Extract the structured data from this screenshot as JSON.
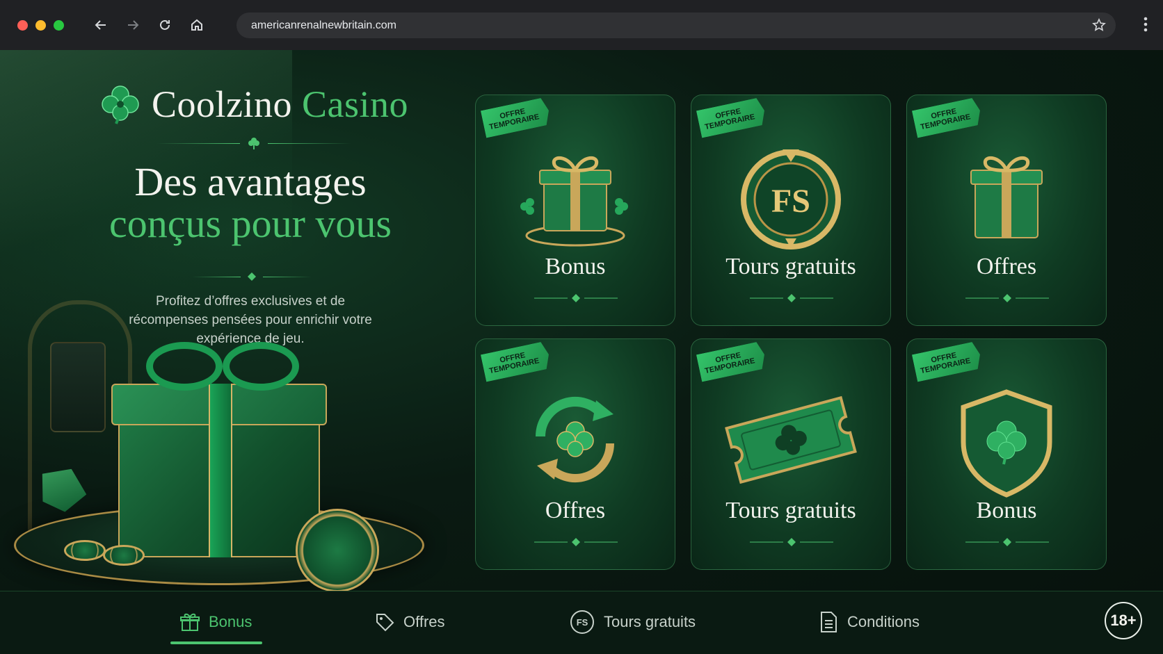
{
  "browser": {
    "url": "americanrenalnewbritain.com",
    "traffic_lights": [
      "#ff5f57",
      "#febc2e",
      "#28c840"
    ],
    "icons": [
      "back-icon",
      "forward-icon",
      "reload-icon",
      "home-icon",
      "star-icon",
      "menu-icon"
    ]
  },
  "brand": {
    "name_part1": "Coolzino",
    "name_part2": "Casino",
    "logo_icon": "clover-icon"
  },
  "hero": {
    "title_line1": "Des avantages",
    "title_line2": "conçus pour vous",
    "description": "Profitez d’offres exclusives et de récompenses pensées pour enrichir votre expérience de jeu."
  },
  "colors": {
    "accent": "#4cc46f",
    "gold": "#c9a75a",
    "background": "#07110c"
  },
  "cards": [
    {
      "ribbon_line1": "OFFRE",
      "ribbon_line2": "TEMPORAIRE",
      "title": "Bonus",
      "icon": "gift-icon"
    },
    {
      "ribbon_line1": "OFFRE",
      "ribbon_line2": "TEMPORAIRE",
      "title": "Tours gratuits",
      "icon": "free-spins-wheel-icon",
      "icon_text": "FS"
    },
    {
      "ribbon_line1": "OFFRE",
      "ribbon_line2": "TEMPORAIRE",
      "title": "Offres",
      "icon": "gift-icon"
    },
    {
      "ribbon_line1": "OFFRE",
      "ribbon_line2": "TEMPORAIRE",
      "title": "Offres",
      "icon": "refresh-clover-icon"
    },
    {
      "ribbon_line1": "OFFRE",
      "ribbon_line2": "TEMPORAIRE",
      "title": "Tours gratuits",
      "icon": "ticket-icon"
    },
    {
      "ribbon_line1": "OFFRE",
      "ribbon_line2": "TEMPORAIRE",
      "title": "Bonus",
      "icon": "shield-clover-icon"
    }
  ],
  "bottom_nav": {
    "items": [
      {
        "label": "Bonus",
        "icon": "gift-icon",
        "active": true
      },
      {
        "label": "Offres",
        "icon": "tag-icon",
        "active": false
      },
      {
        "label": "Tours gratuits",
        "icon": "fs-icon",
        "icon_text": "FS",
        "active": false
      },
      {
        "label": "Conditions",
        "icon": "document-icon",
        "active": false
      }
    ],
    "age_badge": "18+"
  }
}
